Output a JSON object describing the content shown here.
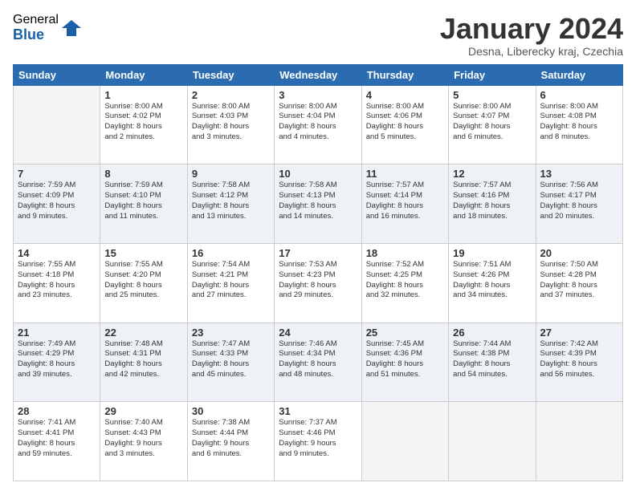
{
  "logo": {
    "general": "General",
    "blue": "Blue"
  },
  "header": {
    "title": "January 2024",
    "subtitle": "Desna, Liberecky kraj, Czechia"
  },
  "days_of_week": [
    "Sunday",
    "Monday",
    "Tuesday",
    "Wednesday",
    "Thursday",
    "Friday",
    "Saturday"
  ],
  "weeks": [
    [
      {
        "day": "",
        "info": ""
      },
      {
        "day": "1",
        "info": "Sunrise: 8:00 AM\nSunset: 4:02 PM\nDaylight: 8 hours\nand 2 minutes."
      },
      {
        "day": "2",
        "info": "Sunrise: 8:00 AM\nSunset: 4:03 PM\nDaylight: 8 hours\nand 3 minutes."
      },
      {
        "day": "3",
        "info": "Sunrise: 8:00 AM\nSunset: 4:04 PM\nDaylight: 8 hours\nand 4 minutes."
      },
      {
        "day": "4",
        "info": "Sunrise: 8:00 AM\nSunset: 4:06 PM\nDaylight: 8 hours\nand 5 minutes."
      },
      {
        "day": "5",
        "info": "Sunrise: 8:00 AM\nSunset: 4:07 PM\nDaylight: 8 hours\nand 6 minutes."
      },
      {
        "day": "6",
        "info": "Sunrise: 8:00 AM\nSunset: 4:08 PM\nDaylight: 8 hours\nand 8 minutes."
      }
    ],
    [
      {
        "day": "7",
        "info": "Sunrise: 7:59 AM\nSunset: 4:09 PM\nDaylight: 8 hours\nand 9 minutes."
      },
      {
        "day": "8",
        "info": "Sunrise: 7:59 AM\nSunset: 4:10 PM\nDaylight: 8 hours\nand 11 minutes."
      },
      {
        "day": "9",
        "info": "Sunrise: 7:58 AM\nSunset: 4:12 PM\nDaylight: 8 hours\nand 13 minutes."
      },
      {
        "day": "10",
        "info": "Sunrise: 7:58 AM\nSunset: 4:13 PM\nDaylight: 8 hours\nand 14 minutes."
      },
      {
        "day": "11",
        "info": "Sunrise: 7:57 AM\nSunset: 4:14 PM\nDaylight: 8 hours\nand 16 minutes."
      },
      {
        "day": "12",
        "info": "Sunrise: 7:57 AM\nSunset: 4:16 PM\nDaylight: 8 hours\nand 18 minutes."
      },
      {
        "day": "13",
        "info": "Sunrise: 7:56 AM\nSunset: 4:17 PM\nDaylight: 8 hours\nand 20 minutes."
      }
    ],
    [
      {
        "day": "14",
        "info": "Sunrise: 7:55 AM\nSunset: 4:18 PM\nDaylight: 8 hours\nand 23 minutes."
      },
      {
        "day": "15",
        "info": "Sunrise: 7:55 AM\nSunset: 4:20 PM\nDaylight: 8 hours\nand 25 minutes."
      },
      {
        "day": "16",
        "info": "Sunrise: 7:54 AM\nSunset: 4:21 PM\nDaylight: 8 hours\nand 27 minutes."
      },
      {
        "day": "17",
        "info": "Sunrise: 7:53 AM\nSunset: 4:23 PM\nDaylight: 8 hours\nand 29 minutes."
      },
      {
        "day": "18",
        "info": "Sunrise: 7:52 AM\nSunset: 4:25 PM\nDaylight: 8 hours\nand 32 minutes."
      },
      {
        "day": "19",
        "info": "Sunrise: 7:51 AM\nSunset: 4:26 PM\nDaylight: 8 hours\nand 34 minutes."
      },
      {
        "day": "20",
        "info": "Sunrise: 7:50 AM\nSunset: 4:28 PM\nDaylight: 8 hours\nand 37 minutes."
      }
    ],
    [
      {
        "day": "21",
        "info": "Sunrise: 7:49 AM\nSunset: 4:29 PM\nDaylight: 8 hours\nand 39 minutes."
      },
      {
        "day": "22",
        "info": "Sunrise: 7:48 AM\nSunset: 4:31 PM\nDaylight: 8 hours\nand 42 minutes."
      },
      {
        "day": "23",
        "info": "Sunrise: 7:47 AM\nSunset: 4:33 PM\nDaylight: 8 hours\nand 45 minutes."
      },
      {
        "day": "24",
        "info": "Sunrise: 7:46 AM\nSunset: 4:34 PM\nDaylight: 8 hours\nand 48 minutes."
      },
      {
        "day": "25",
        "info": "Sunrise: 7:45 AM\nSunset: 4:36 PM\nDaylight: 8 hours\nand 51 minutes."
      },
      {
        "day": "26",
        "info": "Sunrise: 7:44 AM\nSunset: 4:38 PM\nDaylight: 8 hours\nand 54 minutes."
      },
      {
        "day": "27",
        "info": "Sunrise: 7:42 AM\nSunset: 4:39 PM\nDaylight: 8 hours\nand 56 minutes."
      }
    ],
    [
      {
        "day": "28",
        "info": "Sunrise: 7:41 AM\nSunset: 4:41 PM\nDaylight: 8 hours\nand 59 minutes."
      },
      {
        "day": "29",
        "info": "Sunrise: 7:40 AM\nSunset: 4:43 PM\nDaylight: 9 hours\nand 3 minutes."
      },
      {
        "day": "30",
        "info": "Sunrise: 7:38 AM\nSunset: 4:44 PM\nDaylight: 9 hours\nand 6 minutes."
      },
      {
        "day": "31",
        "info": "Sunrise: 7:37 AM\nSunset: 4:46 PM\nDaylight: 9 hours\nand 9 minutes."
      },
      {
        "day": "",
        "info": ""
      },
      {
        "day": "",
        "info": ""
      },
      {
        "day": "",
        "info": ""
      }
    ]
  ]
}
